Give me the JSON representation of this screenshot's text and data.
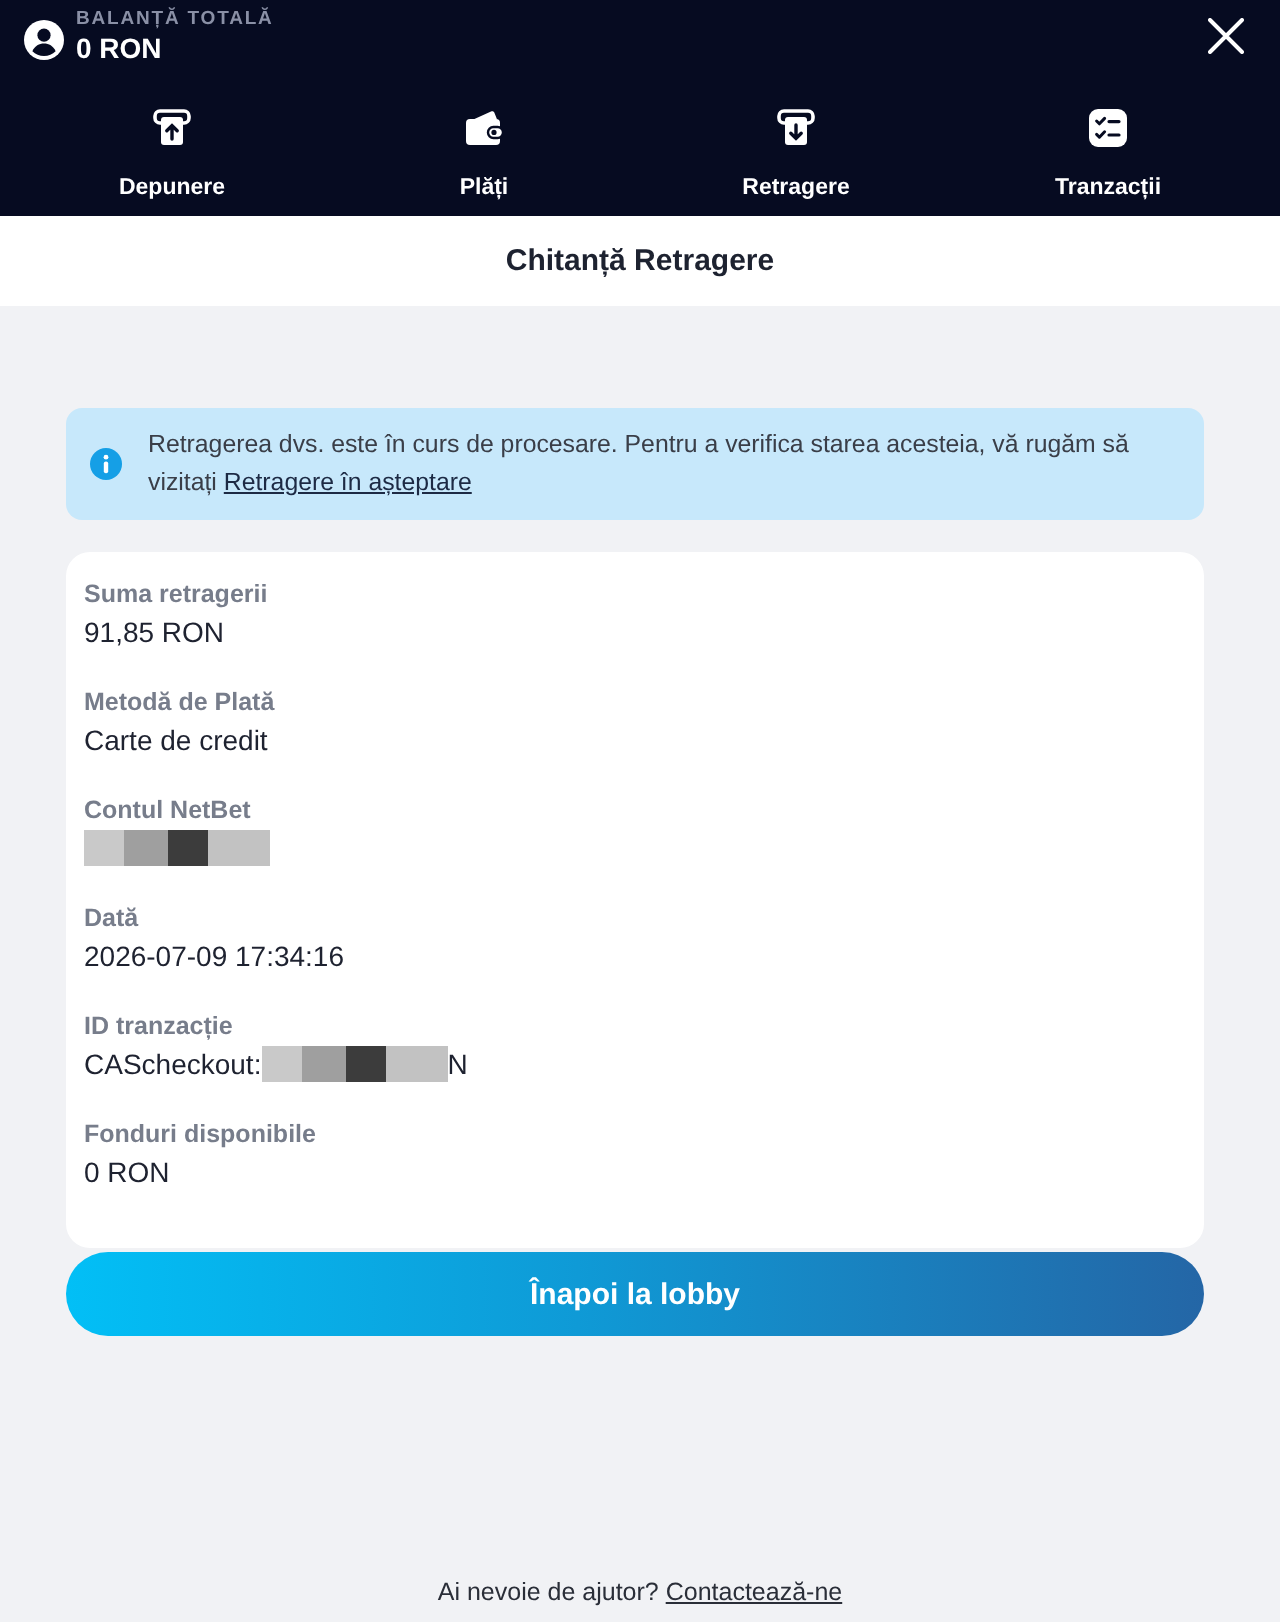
{
  "header": {
    "balance_label": "BALANȚĂ TOTALĂ",
    "balance": "0 RON"
  },
  "nav": [
    {
      "label": "Depunere",
      "kind": "deposit"
    },
    {
      "label": "Plăți",
      "kind": "wallet"
    },
    {
      "label": "Retragere",
      "kind": "withdraw"
    },
    {
      "label": "Tranzacții",
      "kind": "transactions"
    }
  ],
  "title": "Chitanță Retragere",
  "notice": {
    "text": "Retragerea dvs. este în curs de procesare. Pentru a verifica starea acesteia, vă rugăm să vizitați",
    "link": "Retragere în așteptare"
  },
  "details": [
    {
      "label": "Suma retragerii",
      "value": "91,85 RON",
      "redacted": false
    },
    {
      "label": "Metodă de Plată",
      "value": "Carte de credit",
      "redacted": false
    },
    {
      "label": "Contul NetBet",
      "redacted": true
    },
    {
      "label": "Dată",
      "value": "2026-07-09 17:34:16",
      "redacted": false
    },
    {
      "label": "ID tranzacție",
      "value": "CAScheckout:",
      "redacted": true,
      "value_end": "N"
    },
    {
      "label": "Fonduri disponibile",
      "value": "0 RON",
      "redacted": false
    }
  ],
  "button": "Înapoi la lobby",
  "footer": {
    "text": "Ai nevoie de ajutor?",
    "link": "Contactează-ne"
  }
}
